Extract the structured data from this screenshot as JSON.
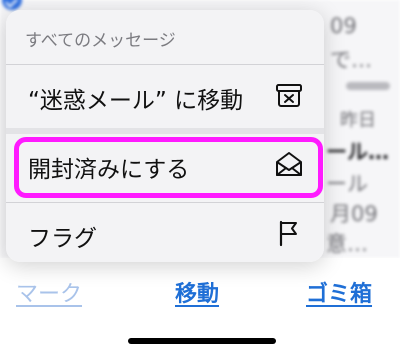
{
  "background_list": {
    "row1_date": "09",
    "row1_snippet": "で…",
    "row2_date": "昨日",
    "row2_title": "ール…",
    "row2_snippet": "ール",
    "row3_date": "月09",
    "row3_snippet": "意…"
  },
  "menu": {
    "header": "すべてのメッセージ",
    "items": [
      {
        "label": "“迷惑メール” に移動",
        "icon": "junk-box-icon"
      },
      {
        "label": "開封済みにする",
        "icon": "open-envelope-icon"
      },
      {
        "label": "フラグ",
        "icon": "flag-icon"
      }
    ],
    "highlight_color": "#ff1aff"
  },
  "toolbar": {
    "mark_label": "マーク",
    "move_label": "移動",
    "trash_label": "ゴミ箱"
  },
  "colors": {
    "accent": "#1f6fd6",
    "accent_disabled": "#a9c3ea"
  }
}
